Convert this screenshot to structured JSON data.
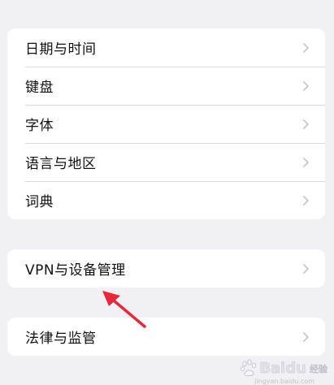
{
  "settings": {
    "group1": [
      {
        "label": "日期与时间"
      },
      {
        "label": "键盘"
      },
      {
        "label": "字体"
      },
      {
        "label": "语言与地区"
      },
      {
        "label": "词典"
      }
    ],
    "group2": [
      {
        "label": "VPN与设备管理"
      }
    ],
    "group3": [
      {
        "label": "法律与监管"
      }
    ]
  },
  "annotation": {
    "arrow_color": "#e8283a",
    "arrow_target": "VPN与设备管理"
  },
  "watermark": {
    "text": "Baidu",
    "suffix": "经验",
    "url": "jingyan.baidu.com"
  },
  "colors": {
    "background": "#f1f1f5",
    "card": "#ffffff",
    "separator": "#dcdce0",
    "chevron": "#c4c4c7",
    "text": "#111111"
  }
}
